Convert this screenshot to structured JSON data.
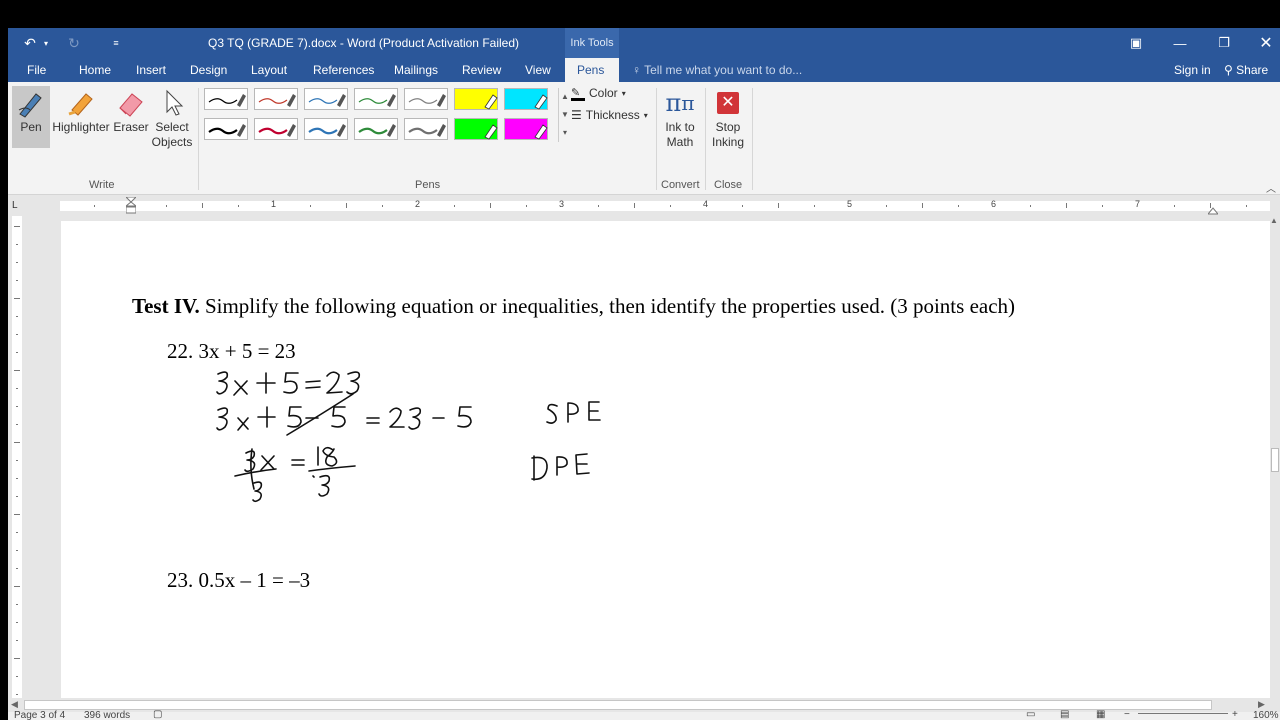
{
  "window": {
    "title": "Q3 TQ (GRADE 7).docx - Word (Product Activation Failed)",
    "context_tab_group": "Ink Tools",
    "controls": [
      "ribbon-display-icon",
      "minimize-icon",
      "restore-icon",
      "close-icon"
    ]
  },
  "qat": {
    "undo_icon": "undo-icon",
    "redo_icon": "redo-icon",
    "customize_icon": "customize-qat-icon"
  },
  "tabs": [
    {
      "label": "File"
    },
    {
      "label": "Home"
    },
    {
      "label": "Insert"
    },
    {
      "label": "Design"
    },
    {
      "label": "Layout"
    },
    {
      "label": "References"
    },
    {
      "label": "Mailings"
    },
    {
      "label": "Review"
    },
    {
      "label": "View"
    },
    {
      "label": "Pens",
      "active": true
    }
  ],
  "tell_me": "Tell me what you want to do...",
  "sign_in": "Sign in",
  "share": "Share",
  "ribbon": {
    "write": {
      "label": "Write",
      "buttons": [
        {
          "label": "Pen",
          "icon": "pen-icon",
          "selected": true
        },
        {
          "label": "Highlighter",
          "icon": "highlighter-icon"
        },
        {
          "label": "Eraser",
          "icon": "eraser-icon"
        },
        {
          "label": "Select",
          "label2": "Objects",
          "icon": "select-objects-icon"
        }
      ]
    },
    "pens": {
      "label": "Pens",
      "swatches_row1": [
        {
          "color": "#000000",
          "kind": "pen"
        },
        {
          "color": "#c0392b",
          "kind": "pen"
        },
        {
          "color": "#2e75b6",
          "kind": "pen"
        },
        {
          "color": "#2e8b3a",
          "kind": "pen"
        },
        {
          "color": "#808080",
          "kind": "pen"
        },
        {
          "color": "#ffff00",
          "kind": "highlighter"
        },
        {
          "color": "#00e5ff",
          "kind": "highlighter"
        }
      ],
      "swatches_row2": [
        {
          "color": "#000000",
          "kind": "pen"
        },
        {
          "color": "#c0002f",
          "kind": "pen"
        },
        {
          "color": "#2e75b6",
          "kind": "pen"
        },
        {
          "color": "#2e8b3a",
          "kind": "pen"
        },
        {
          "color": "#707070",
          "kind": "pen"
        },
        {
          "color": "#00ff00",
          "kind": "highlighter"
        },
        {
          "color": "#ff00ff",
          "kind": "highlighter"
        }
      ],
      "color_label": "Color",
      "thickness_label": "Thickness"
    },
    "convert": {
      "label": "Convert",
      "button": "Ink to",
      "button2": "Math",
      "icon": "ink-to-math-icon"
    },
    "close": {
      "label": "Close",
      "button": "Stop",
      "button2": "Inking",
      "icon": "stop-inking-icon",
      "accent": "#d13438"
    }
  },
  "ruler_numbers": [
    "1",
    "2",
    "3",
    "4",
    "5",
    "6",
    "7"
  ],
  "document": {
    "heading_bold": "Test IV.",
    "heading_rest": " Simplify the following equation or inequalities, then identify the properties used. (3 points each)",
    "q22": "22. 3x + 5 = 23",
    "q23": "23. 0.5x – 1 = –3",
    "ink_lines": [
      "3x+5=23",
      "3x+5-5 = 23-5",
      "SPE",
      "3x = 18",
      "DPE",
      "3",
      "3"
    ]
  },
  "status": {
    "page": "Page 3 of 4",
    "words": "396 words",
    "zoom": "160%"
  }
}
